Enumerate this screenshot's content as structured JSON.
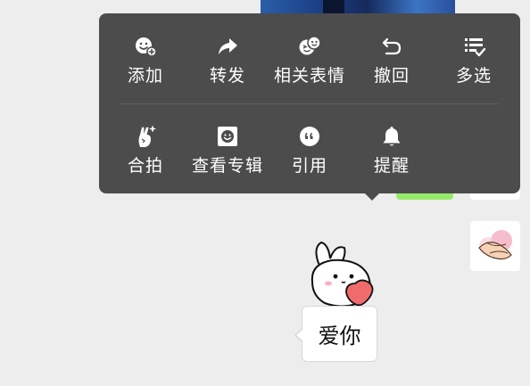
{
  "context_menu": {
    "row1": [
      {
        "label": "添加",
        "icon": "sticker-add-icon"
      },
      {
        "label": "转发",
        "icon": "forward-icon"
      },
      {
        "label": "相关表情",
        "icon": "related-stickers-icon"
      },
      {
        "label": "撤回",
        "icon": "recall-icon"
      },
      {
        "label": "多选",
        "icon": "multi-select-icon"
      }
    ],
    "row2": [
      {
        "label": "合拍",
        "icon": "snap-together-icon"
      },
      {
        "label": "查看专辑",
        "icon": "album-icon"
      },
      {
        "label": "引用",
        "icon": "quote-icon"
      },
      {
        "label": "提醒",
        "icon": "bell-icon"
      }
    ]
  },
  "chat": {
    "sticker_caption": "爱你"
  },
  "colors": {
    "menu_background": "#4c4c4c",
    "chat_background": "#ededed",
    "sent_bubble": "#95ec69",
    "heart": "#f06b6b"
  }
}
